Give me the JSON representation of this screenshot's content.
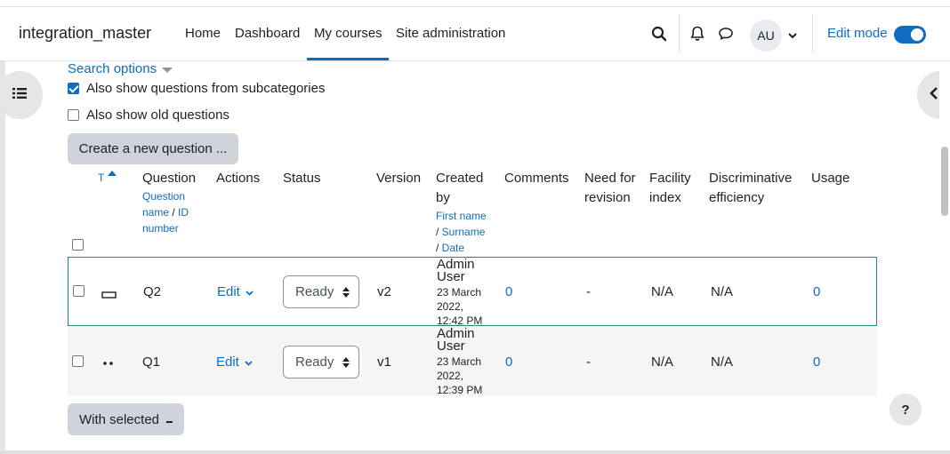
{
  "navbar": {
    "brand": "integration_master",
    "items": [
      "Home",
      "Dashboard",
      "My courses",
      "Site administration"
    ],
    "active_item": "My courses",
    "user_initials": "AU",
    "edit_mode_label": "Edit mode",
    "edit_mode_on": true
  },
  "search": {
    "options_label": "Search options",
    "subcategories_label": "Also show questions from subcategories",
    "subcategories_checked": true,
    "old_questions_label": "Also show old questions",
    "old_questions_checked": false
  },
  "create_button": "Create a new question ...",
  "table": {
    "headers": {
      "type": "T",
      "question": "Question",
      "question_sub_name": "Question name",
      "question_sub_id": "ID number",
      "actions": "Actions",
      "status": "Status",
      "version": "Version",
      "created": "Created by",
      "created_sub_first": "First name",
      "created_sub_surname": "Surname",
      "created_sub_date": "Date",
      "comments": "Comments",
      "need_revision": "Need for revision",
      "facility": "Facility index",
      "discriminative": "Discriminative efficiency",
      "usage": "Usage"
    },
    "rows": [
      {
        "type_icon": "short-answer-icon",
        "name": "Q2",
        "action": "Edit",
        "status": "Ready",
        "version": "v2",
        "created_by": "Admin User",
        "created_date": "23 March 2022, 12:42 PM",
        "comments": "0",
        "need_revision": "-",
        "facility": "N/A",
        "discriminative": "N/A",
        "usage": "0"
      },
      {
        "type_icon": "matching-icon",
        "name": "Q1",
        "action": "Edit",
        "status": "Ready",
        "version": "v1",
        "created_by": "Admin User",
        "created_date": "23 March 2022, 12:39 PM",
        "comments": "0",
        "need_revision": "-",
        "facility": "N/A",
        "discriminative": "N/A",
        "usage": "0"
      }
    ]
  },
  "with_selected": "With selected",
  "help": "?",
  "colors": {
    "link": "#0f6cbf",
    "row_highlight_border": "#1b8a7a",
    "secondary_button": "#ced4da"
  }
}
